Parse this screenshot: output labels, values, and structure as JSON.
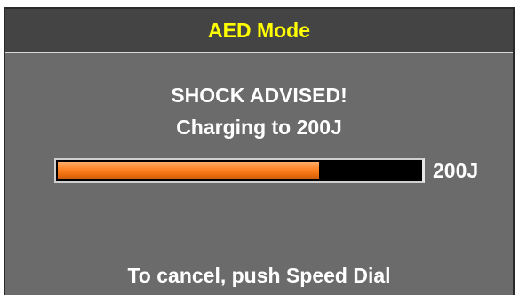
{
  "window": {
    "title": "AED Mode"
  },
  "status": {
    "line1": "SHOCK ADVISED!",
    "line2": "Charging to 200J"
  },
  "charge": {
    "target_label": "200J",
    "progress_fraction": 0.72,
    "fill_color": "#ff8a30"
  },
  "footer": {
    "hint": "To cancel, push Speed Dial"
  },
  "colors": {
    "title_text": "#ffff00",
    "background": "#6b6b6b",
    "title_bar": "#444444"
  }
}
